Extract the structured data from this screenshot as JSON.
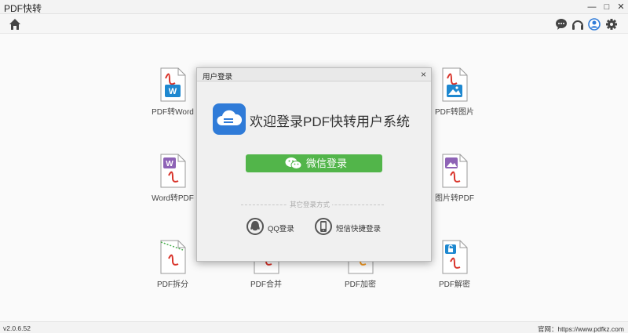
{
  "window": {
    "title": "PDF快转"
  },
  "tools": [
    {
      "label": "PDF转Word",
      "badge": "W",
      "badge_color": "#1e88d0"
    },
    {
      "label": "PDF转图片",
      "badge": "img",
      "badge_color": "#1e88d0"
    },
    {
      "label": "Word转PDF",
      "badge": "W",
      "badge_color": "#8e63b6"
    },
    {
      "label": "图片转PDF",
      "badge": "img",
      "badge_color": "#8e63b6"
    },
    {
      "label": "PDF拆分",
      "badge": "split",
      "badge_color": "#4caf50"
    },
    {
      "label": "PDF合并",
      "badge": "",
      "badge_color": "#999999"
    },
    {
      "label": "PDF加密",
      "badge": "",
      "badge_color": "#f59a23"
    },
    {
      "label": "PDF解密",
      "badge": "lock",
      "badge_color": "#1e88d0"
    }
  ],
  "dialog": {
    "title": "用户登录",
    "close": "×",
    "welcome": "欢迎登录PDF快转用户系统",
    "wechat_button": "微信登录",
    "other_methods": "其它登录方式",
    "qq": "QQ登录",
    "sms": "短信快捷登录"
  },
  "footer": {
    "version": "v2.0.6.52",
    "site": "官网：https://www.pdfkz.com"
  },
  "colors": {
    "accent": "#52b54a",
    "pdf_red": "#d9342b",
    "blue": "#2f7bd8"
  }
}
